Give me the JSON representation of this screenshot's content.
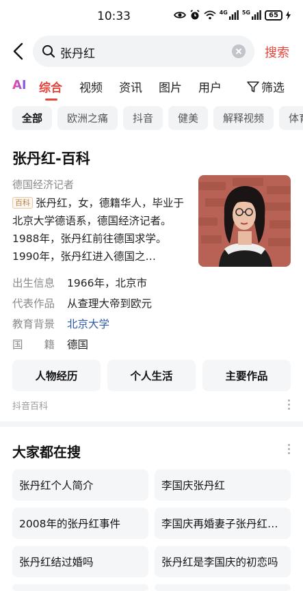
{
  "status_bar": {
    "time": "10:33",
    "network_1": "4G",
    "network_2": "5G",
    "battery": "65"
  },
  "search": {
    "query": "张丹红",
    "submit_label": "搜索"
  },
  "tabs": {
    "items": [
      "AI",
      "综合",
      "视频",
      "资讯",
      "图片",
      "用户"
    ],
    "active": "综合",
    "filter_label": "筛选"
  },
  "chips": [
    "全部",
    "欧洲之痛",
    "抖音",
    "健美",
    "解释视频",
    "体育"
  ],
  "baike": {
    "title": "张丹红-百科",
    "subtitle": "德国经济记者",
    "tag": "百科",
    "summary": "张丹红，女，德籍华人，毕业于北京大学德语系，德国经济记者。1988年，张丹红前往德国求学。1990年，张丹红进入德国之…",
    "info": [
      {
        "label": "出生信息",
        "value": "1966年，北京市"
      },
      {
        "label": "代表作品",
        "value": "从查理大帝到欧元"
      },
      {
        "label": "教育背景",
        "value": "北京大学"
      },
      {
        "label": "国　　籍",
        "value": "德国"
      }
    ],
    "buttons": [
      "人物经历",
      "个人生活",
      "主要作品"
    ],
    "source": "抖音百科"
  },
  "related": {
    "title": "大家都在搜",
    "items": [
      "张丹红个人简介",
      "李国庆张丹红",
      "2008年的张丹红事件",
      "李国庆再婚妻子张丹红…",
      "张丹红结过婚吗",
      "张丹红是李国庆的初恋吗"
    ]
  },
  "colors": {
    "accent": "#e8423b",
    "link": "#2e57a8",
    "chip_bg": "#f2f3f5"
  }
}
